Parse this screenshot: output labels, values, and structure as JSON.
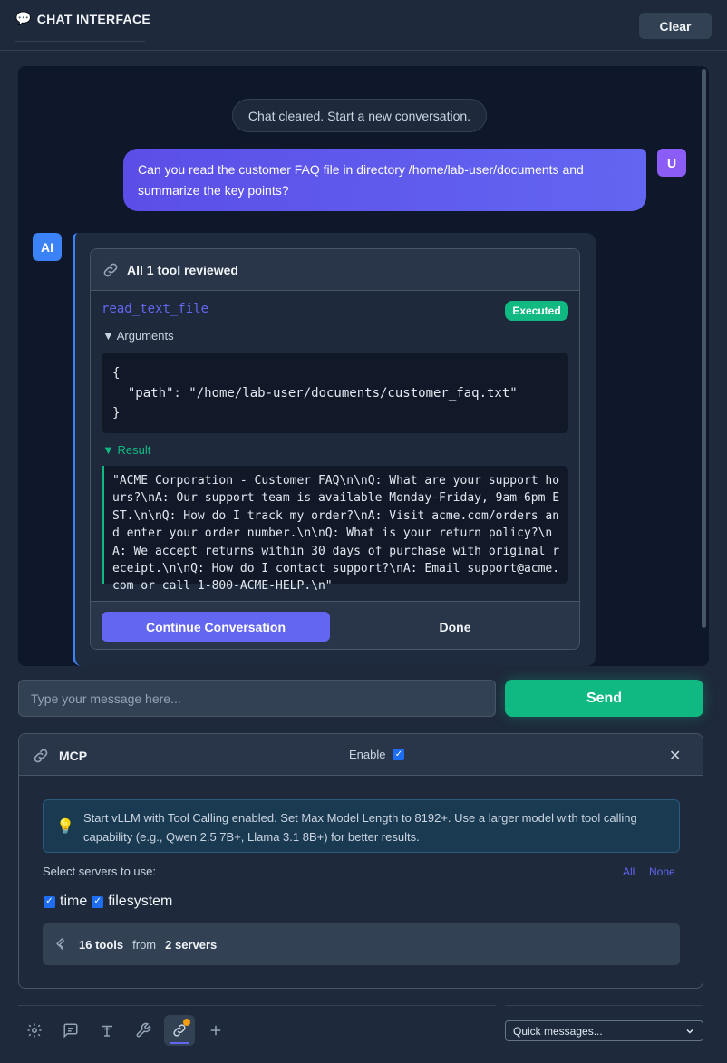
{
  "header": {
    "emoji": "💬",
    "title": "CHAT INTERFACE",
    "clear_label": "Clear"
  },
  "chat": {
    "system_message": "Chat cleared. Start a new conversation.",
    "user_avatar": "U",
    "user_message": "Can you read the customer FAQ file in directory /home/lab-user/documents and summarize the key points?",
    "ai_avatar": "AI",
    "tool_card": {
      "header": "All 1 tool reviewed",
      "tool_name": "read_text_file",
      "status": "Executed",
      "arguments_label": "▼ Arguments",
      "arguments": "{\n  \"path\": \"/home/lab-user/documents/customer_faq.txt\"\n}",
      "result_label": "▼ Result",
      "result": "\"ACME Corporation - Customer FAQ\\n\\nQ: What are your support hours?\\nA: Our support team is available Monday-Friday, 9am-6pm EST.\\n\\nQ: How do I track my order?\\nA: Visit acme.com/orders and enter your order number.\\n\\nQ: What is your return policy?\\nA: We accept returns within 30 days of purchase with original receipt.\\n\\nQ: How do I contact support?\\nA: Email support@acme.com or call 1-800-ACME-HELP.\\n\"",
      "continue_label": "Continue Conversation",
      "done_label": "Done"
    }
  },
  "composer": {
    "placeholder": "Type your message here...",
    "send_label": "Send"
  },
  "mcp": {
    "title": "MCP",
    "enable_label": "Enable",
    "enabled": true,
    "hint": "Start vLLM with Tool Calling enabled. Set Max Model Length to 8192+. Use a larger model with tool calling capability (e.g., Qwen 2.5 7B+, Llama 3.1 8B+) for better results.",
    "select_label": "Select servers to use:",
    "all_label": "All",
    "none_label": "None",
    "servers": [
      {
        "name": "time",
        "checked": true
      },
      {
        "name": "filesystem",
        "checked": true
      }
    ],
    "tools_count": "16 tools",
    "from_label": "from",
    "servers_count": "2 servers"
  },
  "toolbar": {
    "icons": [
      "gear-icon",
      "chat-icon",
      "text-icon",
      "wrench-icon",
      "mcp-link-icon",
      "plus-icon"
    ],
    "quick_messages": "Quick messages..."
  }
}
